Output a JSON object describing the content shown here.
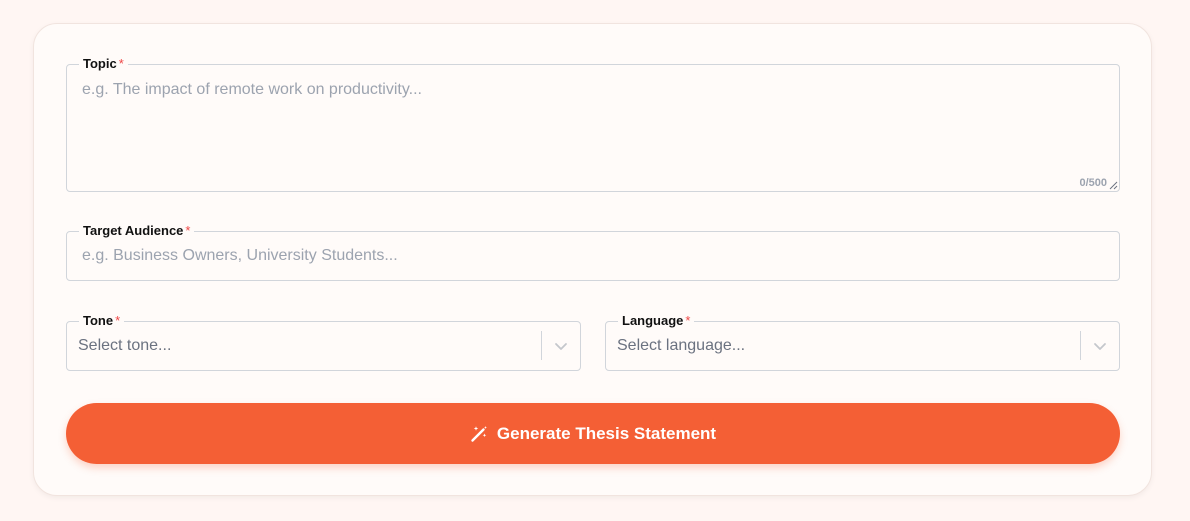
{
  "form": {
    "topic": {
      "label": "Topic",
      "required_mark": "*",
      "placeholder": "e.g. The impact of remote work on productivity...",
      "counter": "0/500"
    },
    "audience": {
      "label": "Target Audience",
      "required_mark": "*",
      "placeholder": "e.g. Business Owners, University Students..."
    },
    "tone": {
      "label": "Tone",
      "required_mark": "*",
      "placeholder": "Select tone..."
    },
    "language": {
      "label": "Language",
      "required_mark": "*",
      "placeholder": "Select language..."
    },
    "submit": {
      "label": "Generate Thesis Statement",
      "icon": "magic-wand-icon"
    }
  },
  "colors": {
    "page_bg": "#fff6f3",
    "card_bg": "#fffbf9",
    "accent": "#f45f35",
    "required": "#ef4444",
    "placeholder": "#9ca3af",
    "border": "#d1d5db"
  }
}
